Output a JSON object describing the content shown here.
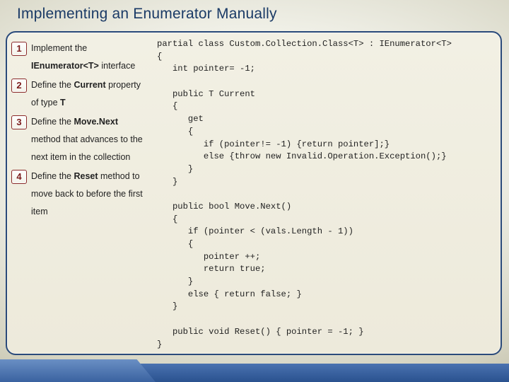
{
  "title": "Implementing an Enumerator Manually",
  "steps": [
    {
      "num": "1",
      "html": "Implement the <b>IEnumerator&lt;T&gt;</b> interface"
    },
    {
      "num": "2",
      "html": "Define the <b>Current</b> property of type <b>T</b>"
    },
    {
      "num": "3",
      "html": "Define the <b>Move.Next</b> method that advances to the next item in the collection"
    },
    {
      "num": "4",
      "html": "Define the <b>Reset</b> method to move back to before the first item"
    }
  ],
  "code": "partial class Custom.Collection.Class<T> : IEnumerator<T>\n{\n   int pointer= -1;\n\n   public T Current\n   {\n      get\n      {\n         if (pointer!= -1) {return pointer];}\n         else {throw new Invalid.Operation.Exception();}\n      }\n   }\n\n   public bool Move.Next()\n   {\n      if (pointer < (vals.Length - 1))\n      {\n         pointer ++;\n         return true;\n      }\n      else { return false; }\n   }\n\n   public void Reset() { pointer = -1; }\n}"
}
